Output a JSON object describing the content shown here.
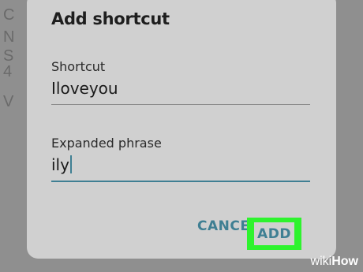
{
  "dialog": {
    "title": "Add shortcut",
    "shortcut_label": "Shortcut",
    "shortcut_value": "Iloveyou",
    "phrase_label": "Expanded phrase",
    "phrase_value": "ily",
    "cancel_label": "CANCEL",
    "add_label": "ADD"
  },
  "background": {
    "chars": [
      "C",
      "N",
      "S",
      "4",
      "V"
    ]
  },
  "watermark": {
    "wiki": "wiki",
    "how": "How"
  },
  "colors": {
    "accent": "#3f7f93",
    "highlight": "#2ef32e",
    "dialog_bg": "#d0d0d0",
    "backdrop": "#8f8f8f"
  }
}
